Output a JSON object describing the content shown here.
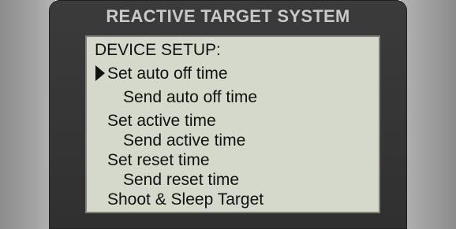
{
  "device": {
    "title": "REACTIVE TARGET SYSTEM"
  },
  "screen": {
    "heading": "DEVICE SETUP:",
    "menu_items": [
      "Set auto off time",
      "Send auto off time",
      "Set active time",
      "Send active time",
      "Set reset time",
      "Send reset time",
      "Shoot & Sleep Target"
    ],
    "selected_index": 0,
    "cursor_icon": "triangle-right-icon"
  },
  "colors": {
    "casing": "#363636",
    "title_text": "#c9c9c9",
    "lcd_background": "#d4d9cc",
    "lcd_text": "#111111"
  }
}
